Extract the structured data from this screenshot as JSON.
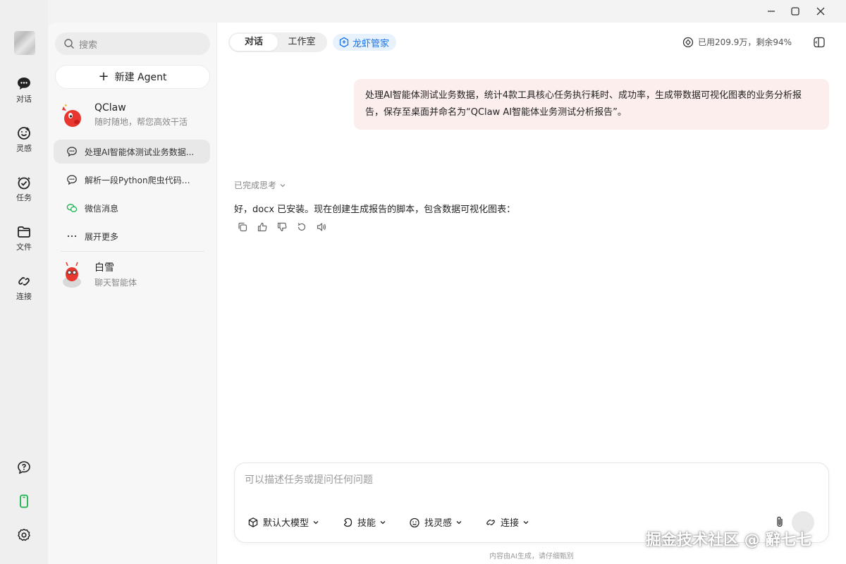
{
  "rail": {
    "items": [
      {
        "label": "对话",
        "icon": "chat-bubble-icon"
      },
      {
        "label": "灵感",
        "icon": "smile-icon"
      },
      {
        "label": "任务",
        "icon": "task-check-icon"
      },
      {
        "label": "文件",
        "icon": "folder-icon"
      },
      {
        "label": "连接",
        "icon": "link-icon"
      }
    ],
    "bottom": {
      "help_icon": "help-icon",
      "phone_icon": "phone-icon",
      "settings_icon": "settings-icon"
    }
  },
  "sidebar": {
    "search_placeholder": "搜索",
    "new_agent_label": "新建 Agent",
    "agents": [
      {
        "name": "QClaw",
        "subtitle": "随时随地，帮您高效干活"
      },
      {
        "name": "白雪",
        "subtitle": "聊天智能体"
      }
    ],
    "conversations": [
      {
        "label": "处理AI智能体测试业务数据...",
        "active": true
      },
      {
        "label": "解析一段Python爬虫代码（...",
        "active": false
      },
      {
        "label": "微信消息",
        "active": false
      },
      {
        "label": "展开更多",
        "active": false
      }
    ]
  },
  "header": {
    "tabs": [
      {
        "label": "对话",
        "selected": true
      },
      {
        "label": "工作室",
        "selected": false
      }
    ],
    "butler_label": "龙虾管家",
    "quota_text": "已用209.9万，剩余94%",
    "accent": "#1a73e8"
  },
  "messages": {
    "user_text": "处理AI智能体测试业务数据，统计4款工具核心任务执行耗时、成功率，生成带数据可视化图表的业务分析报告，保存至桌面并命名为“QClaw AI智能体业务测试分析报告”。",
    "thinking_label": "已完成思考",
    "assistant_text": "好，docx 已安装。现在创建生成报告的脚本，包含数据可视化图表："
  },
  "composer": {
    "placeholder": "可以描述任务或提问任何问题",
    "tools": [
      {
        "label": "默认大模型",
        "icon": "cube-icon"
      },
      {
        "label": "技能",
        "icon": "skill-icon"
      },
      {
        "label": "找灵感",
        "icon": "smile-icon"
      },
      {
        "label": "连接",
        "icon": "link-icon"
      }
    ],
    "disclaimer": "内容由AI生成，请仔细甄别"
  },
  "watermark": "掘金技术社区 @ 辭七七"
}
